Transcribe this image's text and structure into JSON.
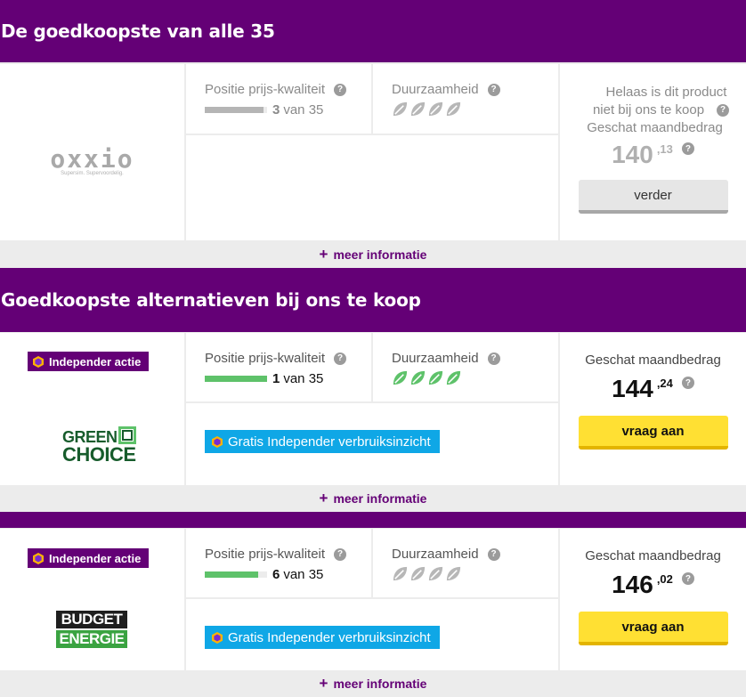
{
  "section1": {
    "title": "De goedkoopste van alle 35"
  },
  "section2": {
    "title": "Goedkoopste alternatieven bij ons te koop"
  },
  "labels": {
    "position": "Positie prijs-kwaliteit",
    "sustainability": "Duurzaamheid",
    "estimate": "Geschat maandbedrag",
    "more": "meer informatie",
    "help": "?",
    "plus": "+"
  },
  "cards": [
    {
      "provider": "oxxio",
      "logo_text": "oxxio",
      "logo_tagline": "Supersim. Supervoordelig.",
      "rank_number": "3",
      "rank_suffix": "van 35",
      "rank_fraction": 0.94,
      "leaves_active": 0,
      "leaves_total": 4,
      "unavailable_line1": "Helaas is dit product",
      "unavailable_line2": "niet bij ons te koop",
      "price_whole": "140",
      "price_cents": ",13",
      "button_label": "verder",
      "accent": "#b5b5b5"
    },
    {
      "provider": "greenchoice",
      "badge": "Independer actie",
      "logo_line1": "GREEN",
      "logo_line2": "CHOICE",
      "rank_number": "1",
      "rank_suffix": "van 35",
      "rank_fraction": 1.0,
      "leaves_active": 4,
      "leaves_total": 4,
      "promo": "Gratis Independer verbruiksinzicht",
      "price_whole": "144",
      "price_cents": ",24",
      "button_label": "vraag aan",
      "accent": "#5ec26a"
    },
    {
      "provider": "budget-energie",
      "badge": "Independer actie",
      "logo_line1": "BUDGET",
      "logo_line2": "ENERGIE",
      "rank_number": "6",
      "rank_suffix": "van 35",
      "rank_fraction": 0.86,
      "leaves_active": 0,
      "leaves_total": 4,
      "promo": "Gratis Independer verbruiksinzicht",
      "price_whole": "146",
      "price_cents": ",02",
      "button_label": "vraag aan",
      "accent": "#5ec26a"
    }
  ],
  "colors": {
    "brand_purple": "#640076",
    "leaf_green": "#5ec26a",
    "leaf_grey": "#b7b7b7",
    "promo_blue": "#0fa7e6",
    "cta_yellow": "#ffe033"
  }
}
